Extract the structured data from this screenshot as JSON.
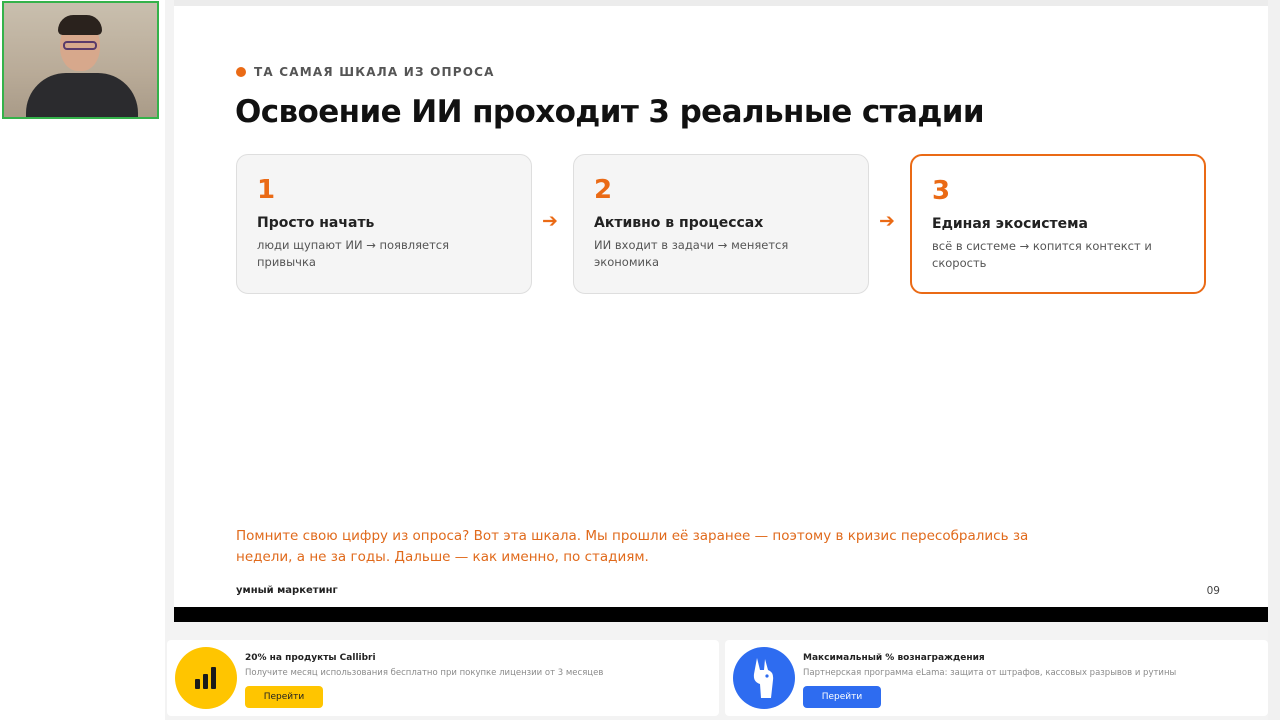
{
  "slide": {
    "eyebrow": "ТА САМАЯ ШКАЛА ИЗ ОПРОСА",
    "headline": "Освоение ИИ проходит 3 реальные стадии",
    "stages": [
      {
        "num": "1",
        "title": "Просто начать",
        "desc": "люди щупают ИИ → появляется привычка"
      },
      {
        "num": "2",
        "title": "Активно в процессах",
        "desc": "ИИ входит в задачи → меняется экономика"
      },
      {
        "num": "3",
        "title": "Единая экосистема",
        "desc": "всё в системе → копится контекст и скорость"
      }
    ],
    "arrow": "➔",
    "quote": "Помните свою цифру из опроса? Вот эта шкала. Мы прошли её заранее — поэтому в кризис пересобрались за недели, а не за годы. Дальше — как именно, по стадиям.",
    "brand": "умный маркетинг",
    "page_number": "09",
    "accent_color": "#ea6a15"
  },
  "ads": [
    {
      "title": "20% на продукты Callibri",
      "subtitle": "Получите месяц использования бесплатно при покупке лицензии от 3 месяцев",
      "button": "Перейти",
      "color": "#ffc500",
      "icon": "bars-chart-icon"
    },
    {
      "title": "Максимальный % вознаграждения",
      "subtitle": "Партнерская программа eLama: защита от штрафов, кассовых разрывов и рутины",
      "button": "Перейти",
      "color": "#2e6cf0",
      "icon": "llama-icon"
    }
  ],
  "webcam": {
    "icon": "participant-video"
  }
}
